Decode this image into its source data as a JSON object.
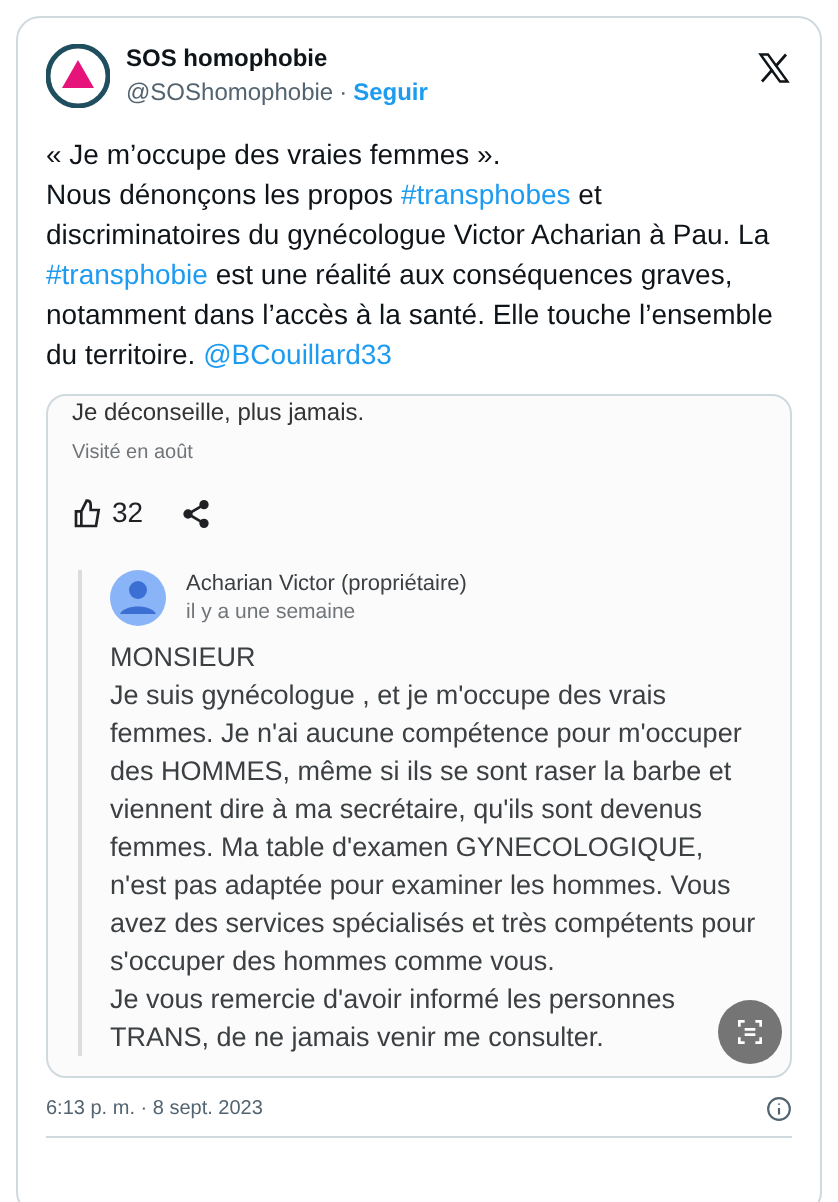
{
  "author": {
    "name": "SOS homophobie",
    "handle": "@SOShomophobie",
    "separator": "·",
    "follow": "Seguir"
  },
  "tweet": {
    "paragraphs": [
      [
        {
          "kind": "text",
          "text": "« Je m’occupe des vraies femmes »."
        }
      ],
      [
        {
          "kind": "text",
          "text": "Nous dénonçons les propos "
        },
        {
          "kind": "link",
          "text": "#transphobes"
        },
        {
          "kind": "text",
          "text": " et discriminatoires du gynécologue Victor Acharian à Pau. La "
        },
        {
          "kind": "link",
          "text": "#transphobie"
        },
        {
          "kind": "text",
          "text": " est une réalité aux conséquences graves, notamment dans l’accès à la santé. Elle touche l’ensemble du territoire. "
        },
        {
          "kind": "link",
          "text": "@BCouillard33"
        }
      ]
    ]
  },
  "screenshot": {
    "cut_line": "Je déconseille, plus jamais.",
    "visited": "Visité en août",
    "likes": "32",
    "reply": {
      "author": "Acharian Victor (propriétaire)",
      "time": "il y a une semaine",
      "paragraphs": [
        "MONSIEUR",
        "Je suis gynécologue , et je m'occupe des vrais femmes. Je n'ai aucune compétence pour m'occuper des HOMMES, même si ils se sont raser la barbe et viennent dire à ma secrétaire, qu'ils sont devenus femmes. Ma table d'examen GYNECOLOGIQUE, n'est pas adaptée pour examiner les hommes. Vous avez des services spécialisés et très compétents pour s'occuper des hommes comme vous.",
        "Je vous remercie d'avoir informé les personnes TRANS, de ne jamais venir me consulter."
      ]
    }
  },
  "timestamp": "6:13 p. m. · 8 sept. 2023"
}
